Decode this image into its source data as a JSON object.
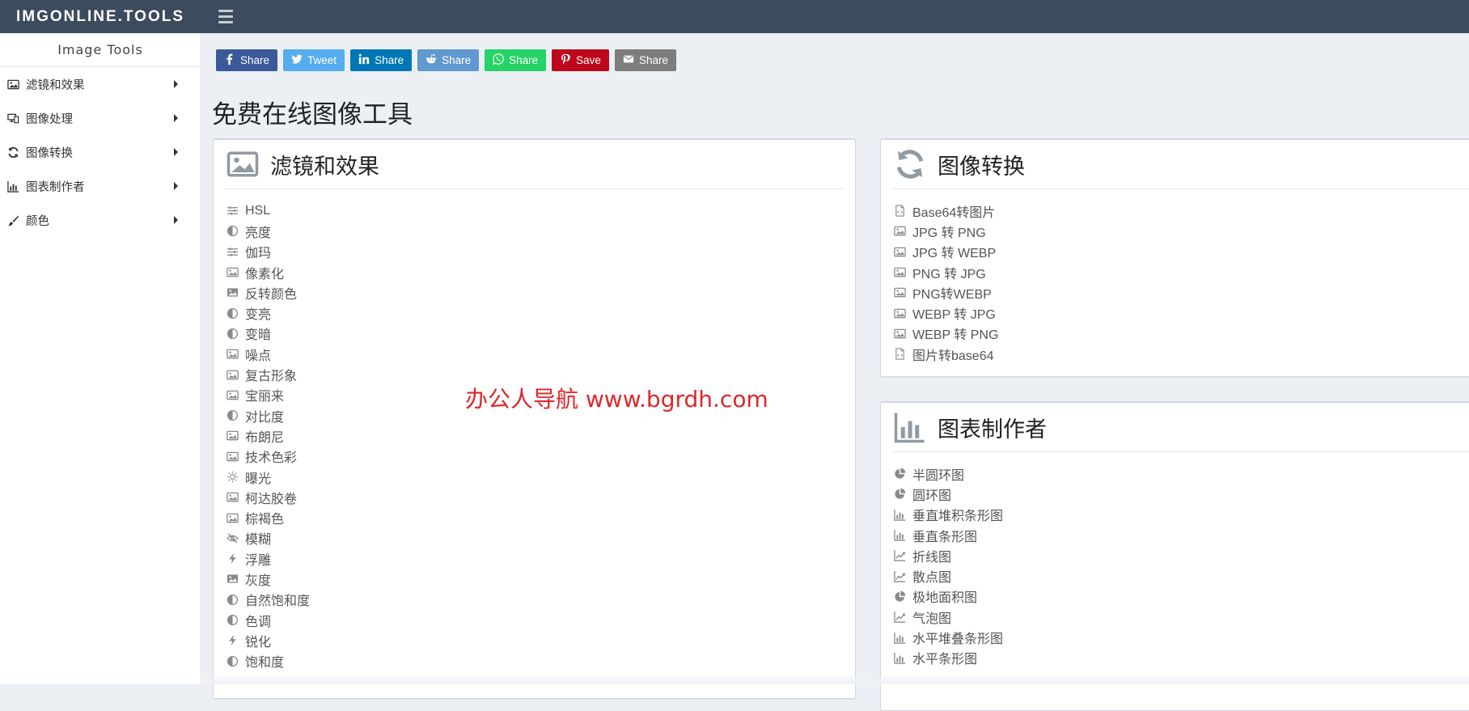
{
  "brand": {
    "logo_text": "IMGONLINE.TOOLS"
  },
  "sidebar": {
    "title": "Image Tools",
    "items": [
      {
        "label": "滤镜和效果",
        "icon": "image-icon"
      },
      {
        "label": "图像处理",
        "icon": "devices-icon"
      },
      {
        "label": "图像转换",
        "icon": "refresh-icon"
      },
      {
        "label": "图表制作者",
        "icon": "bar-chart-icon"
      },
      {
        "label": "颜色",
        "icon": "paintbrush-icon"
      }
    ]
  },
  "share": [
    {
      "label": "Share",
      "icon": "facebook-icon",
      "color": "#3b5998"
    },
    {
      "label": "Tweet",
      "icon": "twitter-icon",
      "color": "#55acee"
    },
    {
      "label": "Share",
      "icon": "linkedin-icon",
      "color": "#0077b5"
    },
    {
      "label": "Share",
      "icon": "reddit-icon",
      "color": "#5f99cf"
    },
    {
      "label": "Share",
      "icon": "whatsapp-icon",
      "color": "#25d366"
    },
    {
      "label": "Save",
      "icon": "pinterest-icon",
      "color": "#bd081c"
    },
    {
      "label": "Share",
      "icon": "email-icon",
      "color": "#7d7d7d"
    }
  ],
  "page_title": "免费在线图像工具",
  "panels": {
    "filters": {
      "title": "滤镜和效果",
      "icon": "image-icon",
      "items": [
        {
          "label": "HSL",
          "icon": "sliders-icon"
        },
        {
          "label": "亮度",
          "icon": "contrast-icon"
        },
        {
          "label": "伽玛",
          "icon": "sliders-icon"
        },
        {
          "label": "像素化",
          "icon": "image-icon"
        },
        {
          "label": "反转颜色",
          "icon": "image-filled-icon"
        },
        {
          "label": "变亮",
          "icon": "contrast-icon"
        },
        {
          "label": "变暗",
          "icon": "contrast-icon"
        },
        {
          "label": "噪点",
          "icon": "image-icon"
        },
        {
          "label": "复古形象",
          "icon": "image-icon"
        },
        {
          "label": "宝丽来",
          "icon": "image-icon"
        },
        {
          "label": "对比度",
          "icon": "contrast-icon"
        },
        {
          "label": "布朗尼",
          "icon": "image-icon"
        },
        {
          "label": "技术色彩",
          "icon": "image-icon"
        },
        {
          "label": "曝光",
          "icon": "sun-icon"
        },
        {
          "label": "柯达胶卷",
          "icon": "image-icon"
        },
        {
          "label": "棕褐色",
          "icon": "image-icon"
        },
        {
          "label": "模糊",
          "icon": "eye-slash-icon"
        },
        {
          "label": "浮雕",
          "icon": "bolt-icon"
        },
        {
          "label": "灰度",
          "icon": "image-filled-icon"
        },
        {
          "label": "自然饱和度",
          "icon": "contrast-icon"
        },
        {
          "label": "色调",
          "icon": "contrast-icon"
        },
        {
          "label": "锐化",
          "icon": "bolt-icon"
        },
        {
          "label": "饱和度",
          "icon": "contrast-icon"
        }
      ]
    },
    "conversion": {
      "title": "图像转换",
      "icon": "refresh-icon",
      "items": [
        {
          "label": "Base64转图片",
          "icon": "code-file-icon"
        },
        {
          "label": "JPG 转 PNG",
          "icon": "image-icon"
        },
        {
          "label": "JPG 转 WEBP",
          "icon": "image-icon"
        },
        {
          "label": "PNG 转 JPG",
          "icon": "image-icon"
        },
        {
          "label": "PNG转WEBP",
          "icon": "image-icon"
        },
        {
          "label": "WEBP 转 JPG",
          "icon": "image-icon"
        },
        {
          "label": "WEBP 转 PNG",
          "icon": "image-icon"
        },
        {
          "label": "图片转base64",
          "icon": "code-file-icon"
        }
      ]
    },
    "charts": {
      "title": "图表制作者",
      "icon": "bar-chart-icon",
      "items": [
        {
          "label": "半圆环图",
          "icon": "pie-chart-icon"
        },
        {
          "label": "圆环图",
          "icon": "pie-chart-icon"
        },
        {
          "label": "垂直堆积条形图",
          "icon": "bar-chart-icon"
        },
        {
          "label": "垂直条形图",
          "icon": "bar-chart-icon"
        },
        {
          "label": "折线图",
          "icon": "line-chart-icon"
        },
        {
          "label": "散点图",
          "icon": "line-chart-icon"
        },
        {
          "label": "极地面积图",
          "icon": "pie-chart-icon"
        },
        {
          "label": "气泡图",
          "icon": "line-chart-icon"
        },
        {
          "label": "水平堆叠条形图",
          "icon": "bar-chart-icon"
        },
        {
          "label": "水平条形图",
          "icon": "bar-chart-icon"
        }
      ]
    }
  },
  "watermark": "办公人导航 www.bgrdh.com"
}
